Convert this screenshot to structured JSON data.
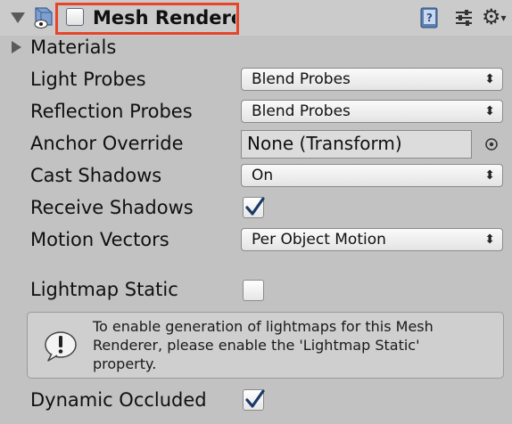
{
  "header": {
    "title": "Mesh Renderer",
    "enabled": false,
    "icons": [
      "fold-arrow-icon",
      "mesh-renderer-icon",
      "help-icon",
      "preset-icon",
      "gear-icon"
    ]
  },
  "materials": {
    "label": "Materials",
    "expanded": false
  },
  "fields": {
    "light_probes": {
      "label": "Light Probes",
      "value": "Blend Probes"
    },
    "reflection_probes": {
      "label": "Reflection Probes",
      "value": "Blend Probes"
    },
    "anchor_override": {
      "label": "Anchor Override",
      "value": "None (Transform)"
    },
    "cast_shadows": {
      "label": "Cast Shadows",
      "value": "On"
    },
    "receive_shadows": {
      "label": "Receive Shadows",
      "checked": true
    },
    "motion_vectors": {
      "label": "Motion Vectors",
      "value": "Per Object Motion"
    },
    "lightmap_static": {
      "label": "Lightmap Static",
      "checked": false
    },
    "dynamic_occluded": {
      "label": "Dynamic Occluded",
      "checked": true
    }
  },
  "help_box": {
    "text": "To enable generation of lightmaps for this Mesh Renderer, please enable the 'Lightmap Static' property.",
    "icon": "info-icon"
  },
  "colors": {
    "background": "#c2c2c2",
    "highlight": "#e8432b",
    "check": "#1a3a66"
  }
}
